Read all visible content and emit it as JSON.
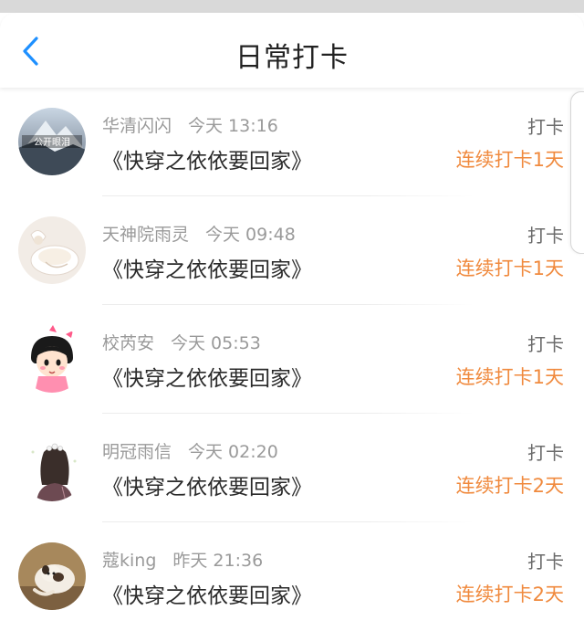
{
  "header": {
    "title": "日常打卡",
    "back_icon": "chevron-left-icon",
    "accent": "#1e90ff"
  },
  "colors": {
    "streak": "#f08a3e",
    "meta": "#9a9a9a"
  },
  "items": [
    {
      "username": "华清闪闪",
      "time": "今天 13:16",
      "book": "《快穿之依依要回家》",
      "action": "打卡",
      "streak": "连续打卡1天",
      "avatar_text": "公开眼泪"
    },
    {
      "username": "天神院雨灵",
      "time": "今天 09:48",
      "book": "《快穿之依依要回家》",
      "action": "打卡",
      "streak": "连续打卡1天"
    },
    {
      "username": "校芮安",
      "time": "今天 05:53",
      "book": "《快穿之依依要回家》",
      "action": "打卡",
      "streak": "连续打卡1天"
    },
    {
      "username": "明冠雨信",
      "time": "今天 02:20",
      "book": "《快穿之依依要回家》",
      "action": "打卡",
      "streak": "连续打卡2天"
    },
    {
      "username": "蔻king",
      "time": "昨天 21:36",
      "book": "《快穿之依依要回家》",
      "action": "打卡",
      "streak": "连续打卡2天"
    }
  ]
}
